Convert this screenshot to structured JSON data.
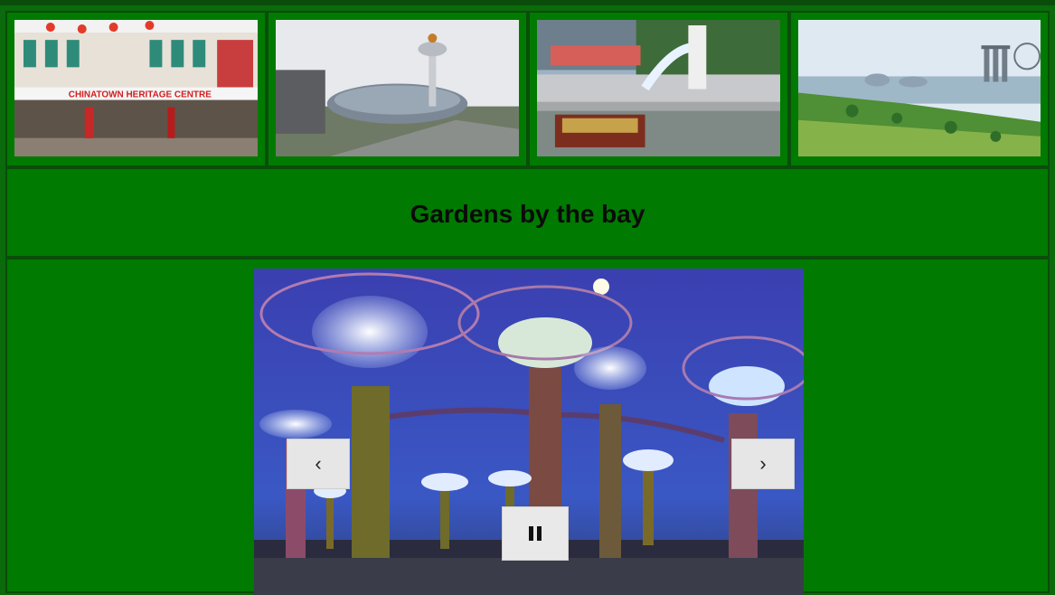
{
  "thumbnails": [
    {
      "name": "thumb-chinatown",
      "sign_text": "CHINATOWN HERITAGE CENTRE"
    },
    {
      "name": "thumb-jewel-airport"
    },
    {
      "name": "thumb-merlion"
    },
    {
      "name": "thumb-marina-bay"
    }
  ],
  "title": "Gardens by the bay",
  "slider": {
    "prev_label": "‹",
    "next_label": "›",
    "pause_icon": "pause-icon"
  },
  "colors": {
    "page_bg": "#0b6a0b",
    "cell_bg": "#007a00",
    "border": "#0a4d0a"
  }
}
